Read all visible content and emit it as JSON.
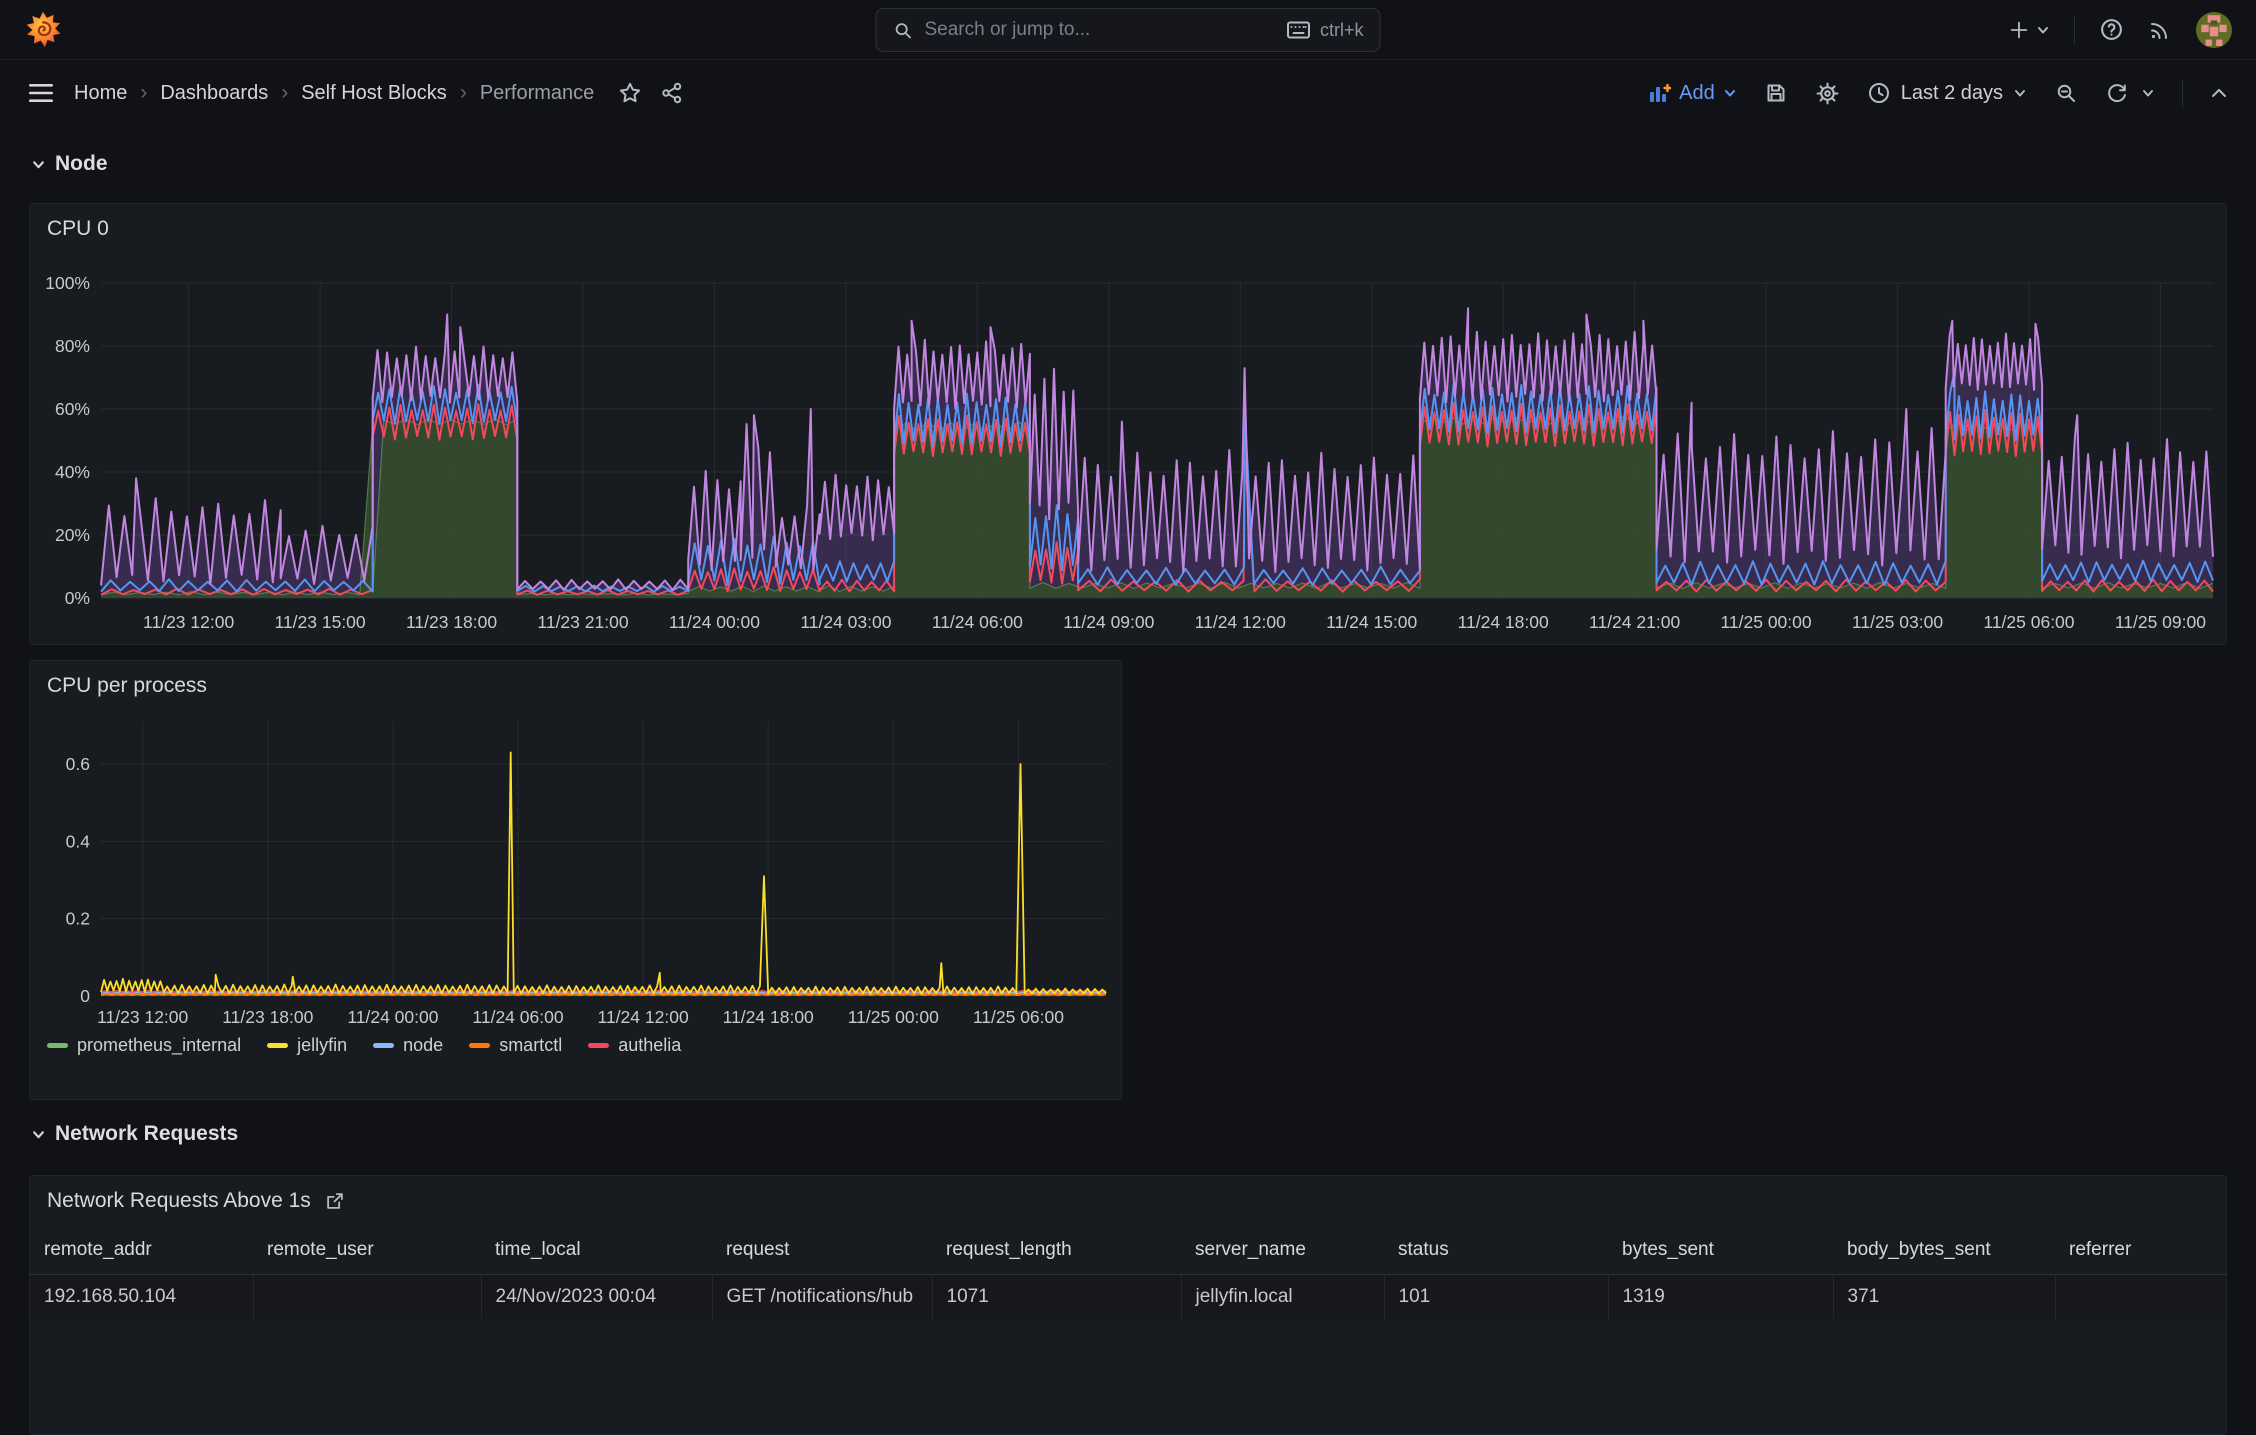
{
  "topnav": {
    "search": {
      "placeholder": "Search or jump to...",
      "shortcut": "ctrl+k"
    }
  },
  "toolbar": {
    "breadcrumbs": [
      {
        "label": "Home"
      },
      {
        "label": "Dashboards"
      },
      {
        "label": "Self Host Blocks"
      },
      {
        "label": "Performance"
      }
    ],
    "add_label": "Add",
    "time_range": "Last 2 days"
  },
  "sections": {
    "node": "Node",
    "network": "Network Requests"
  },
  "panels": {
    "cpu0": {
      "title": "CPU 0"
    },
    "cpu_process": {
      "title": "CPU per process",
      "legend": [
        {
          "label": "prometheus_internal",
          "color": "#73bf69"
        },
        {
          "label": "jellyfin",
          "color": "#fade2a"
        },
        {
          "label": "node",
          "color": "#8ab8ff"
        },
        {
          "label": "smartctl",
          "color": "#ff780a"
        },
        {
          "label": "authelia",
          "color": "#f2495c"
        }
      ]
    },
    "network_table": {
      "title": "Network Requests Above 1s",
      "columns": [
        "remote_addr",
        "remote_user",
        "time_local",
        "request",
        "request_length",
        "server_name",
        "status",
        "bytes_sent",
        "body_bytes_sent",
        "referrer"
      ],
      "rows": [
        [
          "192.168.50.104",
          "",
          "24/Nov/2023 00:04",
          "GET /notifications/hub",
          "1071",
          "jellyfin.local",
          "101",
          "1319",
          "371",
          ""
        ]
      ]
    }
  },
  "chart_data": [
    {
      "id": "cpu0",
      "type": "area-line",
      "title": "CPU 0",
      "t0": 0,
      "t1": 48.2,
      "time_domain": "11/23 10:00 to 11/25 10:00 (Last 2 days)",
      "ylim": [
        0,
        100
      ],
      "yticks": [
        {
          "v": 0,
          "label": "0%"
        },
        {
          "v": 20,
          "label": "20%"
        },
        {
          "v": 40,
          "label": "40%"
        },
        {
          "v": 60,
          "label": "60%"
        },
        {
          "v": 80,
          "label": "80%"
        },
        {
          "v": 100,
          "label": "100%"
        }
      ],
      "xticks": [
        {
          "t": 2,
          "label": "11/23 12:00"
        },
        {
          "t": 5,
          "label": "11/23 15:00"
        },
        {
          "t": 8,
          "label": "11/23 18:00"
        },
        {
          "t": 11,
          "label": "11/23 21:00"
        },
        {
          "t": 14,
          "label": "11/24 00:00"
        },
        {
          "t": 17,
          "label": "11/24 03:00"
        },
        {
          "t": 20,
          "label": "11/24 06:00"
        },
        {
          "t": 23,
          "label": "11/24 09:00"
        },
        {
          "t": 26,
          "label": "11/24 12:00"
        },
        {
          "t": 29,
          "label": "11/24 15:00"
        },
        {
          "t": 32,
          "label": "11/24 18:00"
        },
        {
          "t": 35,
          "label": "11/24 21:00"
        },
        {
          "t": 38,
          "label": "11/25 00:00"
        },
        {
          "t": 41,
          "label": "11/25 03:00"
        },
        {
          "t": 44,
          "label": "11/25 06:00"
        },
        {
          "t": 47,
          "label": "11/25 09:00"
        }
      ],
      "series": [
        {
          "name": "series-purple",
          "color": "#c186e0",
          "fill": "rgba(130,87,189,0.30)",
          "width": 2,
          "fillOrder": 1,
          "lineOrder": 4,
          "segments": [
            [
              0,
              4.1,
              4,
              32,
              0.36
            ],
            [
              4.1,
              6.2,
              4,
              24,
              0.4
            ],
            [
              6.2,
              9.5,
              62,
              80,
              0.22
            ],
            [
              9.5,
              13.4,
              2.5,
              6,
              0.35
            ],
            [
              13.4,
              14.6,
              8,
              42,
              0.28
            ],
            [
              14.6,
              15.4,
              10,
              56,
              0.26
            ],
            [
              15.4,
              16.4,
              8,
              30,
              0.3
            ],
            [
              16.4,
              18.1,
              18,
              40,
              0.24
            ],
            [
              18.1,
              21.2,
              60,
              82,
              0.2
            ],
            [
              21.2,
              22.3,
              24,
              76,
              0.22
            ],
            [
              22.3,
              30.1,
              8,
              47,
              0.3
            ],
            [
              30.1,
              35.5,
              62,
              85,
              0.2
            ],
            [
              35.5,
              42.1,
              10,
              54,
              0.32
            ],
            [
              42.1,
              44.3,
              66,
              84,
              0.18
            ],
            [
              44.3,
              48.2,
              12,
              52,
              0.3
            ]
          ],
          "spikes": [
            [
              0.8,
              38
            ],
            [
              7.9,
              90
            ],
            [
              8.2,
              86
            ],
            [
              14.9,
              58
            ],
            [
              16.2,
              60
            ],
            [
              18.5,
              88
            ],
            [
              20.3,
              86
            ],
            [
              23.3,
              56
            ],
            [
              26.1,
              73
            ],
            [
              31.2,
              92
            ],
            [
              33.9,
              90
            ],
            [
              35.2,
              88
            ],
            [
              36.3,
              62
            ],
            [
              41.2,
              60
            ],
            [
              42.25,
              88
            ],
            [
              44.15,
              87
            ],
            [
              45.1,
              58
            ]
          ]
        },
        {
          "name": "series-green-area",
          "color": "rgba(125,185,110,0.5)",
          "fill": "rgba(52,74,43,0.95)",
          "width": 1.2,
          "fillOrder": 2,
          "lineOrder": 1,
          "segments": [
            [
              0,
              6.2,
              1,
              2,
              0.6
            ],
            [
              6.2,
              9.5,
              55,
              57,
              0.5
            ],
            [
              9.5,
              13.4,
              1,
              1.5,
              0.6
            ],
            [
              13.4,
              18.1,
              2,
              4,
              0.5
            ],
            [
              18.1,
              21.2,
              53,
              56,
              0.5
            ],
            [
              21.2,
              30.1,
              3,
              5,
              0.6
            ],
            [
              30.1,
              35.5,
              55,
              58,
              0.5
            ],
            [
              35.5,
              42.1,
              3,
              5,
              0.6
            ],
            [
              42.1,
              44.3,
              53,
              56,
              0.5
            ],
            [
              44.3,
              48.2,
              3,
              5,
              0.6
            ]
          ],
          "spikes": []
        },
        {
          "name": "series-red",
          "color": "#f2495c",
          "width": 2,
          "lineOrder": 2,
          "segments": [
            [
              0,
              6.2,
              1,
              3,
              0.5
            ],
            [
              6.2,
              9.5,
              50,
              62,
              0.25
            ],
            [
              9.5,
              13.4,
              1,
              2.5,
              0.45
            ],
            [
              13.4,
              16.4,
              2,
              10,
              0.3
            ],
            [
              16.4,
              18.1,
              2,
              6,
              0.35
            ],
            [
              18.1,
              21.2,
              45,
              58,
              0.22
            ],
            [
              21.2,
              22.3,
              4,
              18,
              0.25
            ],
            [
              22.3,
              30.1,
              2,
              6,
              0.5
            ],
            [
              30.1,
              35.5,
              48,
              62,
              0.22
            ],
            [
              35.5,
              42.1,
              2,
              6,
              0.45
            ],
            [
              42.1,
              44.3,
              45,
              60,
              0.2
            ],
            [
              44.3,
              48.2,
              2,
              6,
              0.4
            ]
          ],
          "spikes": [
            [
              26.1,
              45
            ]
          ]
        },
        {
          "name": "series-blue",
          "color": "#5794f2",
          "width": 2,
          "lineOrder": 3,
          "segments": [
            [
              0,
              6.2,
              2,
              6,
              0.45
            ],
            [
              6.2,
              9.5,
              55,
              68,
              0.25
            ],
            [
              9.5,
              13.4,
              2,
              4,
              0.4
            ],
            [
              13.4,
              16.4,
              4,
              20,
              0.3
            ],
            [
              16.4,
              18.1,
              5,
              12,
              0.3
            ],
            [
              18.1,
              21.2,
              48,
              65,
              0.22
            ],
            [
              21.2,
              22.3,
              8,
              30,
              0.25
            ],
            [
              22.3,
              30.1,
              4,
              10,
              0.45
            ],
            [
              30.1,
              35.5,
              52,
              68,
              0.22
            ],
            [
              35.5,
              42.1,
              4,
              12,
              0.4
            ],
            [
              42.1,
              44.3,
              50,
              66,
              0.2
            ],
            [
              44.3,
              48.2,
              5,
              12,
              0.35
            ]
          ],
          "spikes": [
            [
              26.1,
              60
            ],
            [
              42.3,
              72
            ]
          ]
        }
      ]
    },
    {
      "id": "cpupp",
      "type": "line",
      "title": "CPU per process",
      "t0": 0,
      "t1": 48.2,
      "ylim": [
        0,
        0.7
      ],
      "yticks": [
        {
          "v": 0,
          "label": "0"
        },
        {
          "v": 0.2,
          "label": "0.2"
        },
        {
          "v": 0.4,
          "label": "0.4"
        },
        {
          "v": 0.6,
          "label": "0.6"
        }
      ],
      "xticks": [
        {
          "t": 2,
          "label": "11/23 12:00"
        },
        {
          "t": 8,
          "label": "11/23 18:00"
        },
        {
          "t": 14,
          "label": "11/24 00:00"
        },
        {
          "t": 20,
          "label": "11/24 06:00"
        },
        {
          "t": 26,
          "label": "11/24 12:00"
        },
        {
          "t": 32,
          "label": "11/24 18:00"
        },
        {
          "t": 38,
          "label": "11/25 00:00"
        },
        {
          "t": 44,
          "label": "11/25 06:00"
        }
      ],
      "series": [
        {
          "name": "prometheus_internal",
          "color": "#73bf69",
          "width": 1.6,
          "lineOrder": 1,
          "segments": [
            [
              0,
              48.2,
              0.002,
              0.004,
              0.5
            ]
          ],
          "spikes": []
        },
        {
          "name": "node",
          "color": "#8ab8ff",
          "width": 1.6,
          "lineOrder": 2,
          "segments": [
            [
              0,
              48.2,
              0.007,
              0.01,
              0.5
            ]
          ],
          "spikes": []
        },
        {
          "name": "smartctl",
          "color": "#ff780a",
          "width": 1.6,
          "lineOrder": 3,
          "segments": [
            [
              0,
              48.2,
              0.004,
              0.006,
              0.5
            ]
          ],
          "spikes": []
        },
        {
          "name": "authelia",
          "color": "#f2495c",
          "width": 1.8,
          "lineOrder": 4,
          "segments": [
            [
              0,
              48.2,
              0.01,
              0.014,
              0.5
            ]
          ],
          "spikes": []
        },
        {
          "name": "jellyfin",
          "color": "#fade2a",
          "width": 1.8,
          "lineOrder": 5,
          "segments": [
            [
              0,
              3,
              0.01,
              0.045,
              0.3
            ],
            [
              3,
              19.5,
              0.006,
              0.03,
              0.35
            ],
            [
              19.8,
              31.6,
              0.006,
              0.028,
              0.35
            ],
            [
              32,
              43.9,
              0.005,
              0.025,
              0.35
            ],
            [
              44.3,
              48.2,
              0.005,
              0.02,
              0.35
            ]
          ],
          "spikes": [
            [
              5.5,
              0.055
            ],
            [
              9.2,
              0.05
            ],
            [
              19.65,
              0.63
            ],
            [
              26.8,
              0.06
            ],
            [
              31.8,
              0.31
            ],
            [
              40.3,
              0.085
            ],
            [
              44.1,
              0.6
            ]
          ]
        }
      ]
    }
  ]
}
